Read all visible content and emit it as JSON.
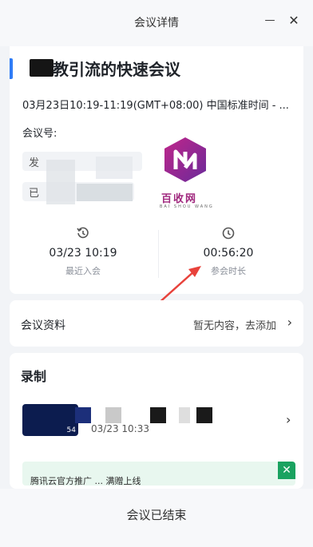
{
  "window": {
    "title": "会议详情",
    "minimize_glyph": "—",
    "close_glyph": "✕"
  },
  "meeting": {
    "subject": "教引流的快速会议",
    "time": "03月23日10:19-11:19(GMT+08:00) 中国标准时间 - ...",
    "number_label": "会议号:",
    "host_label": "发",
    "joined_label": "已"
  },
  "watermark": {
    "brand_cn": "百收网",
    "brand_en": "BAI SHOU WANG"
  },
  "stats": {
    "last_join": {
      "value": "03/23 10:19",
      "label": "最近入会",
      "icon": "history-icon"
    },
    "duration": {
      "value": "00:56:20",
      "label": "参会时长",
      "icon": "clock-icon"
    }
  },
  "materials": {
    "label": "会议资料",
    "value": "暂无内容，去添加"
  },
  "recording": {
    "heading": "录制",
    "items": [
      {
        "time": "03/23 10:33",
        "duration": "54"
      }
    ]
  },
  "banner": {
    "text": "腾讯云官方推广  ...  满赠上线"
  },
  "footer": {
    "status": "会议已结束"
  },
  "colors": {
    "accent": "#2f7cf6",
    "arrow": "#e8423b",
    "banner_green": "#1aa260"
  }
}
